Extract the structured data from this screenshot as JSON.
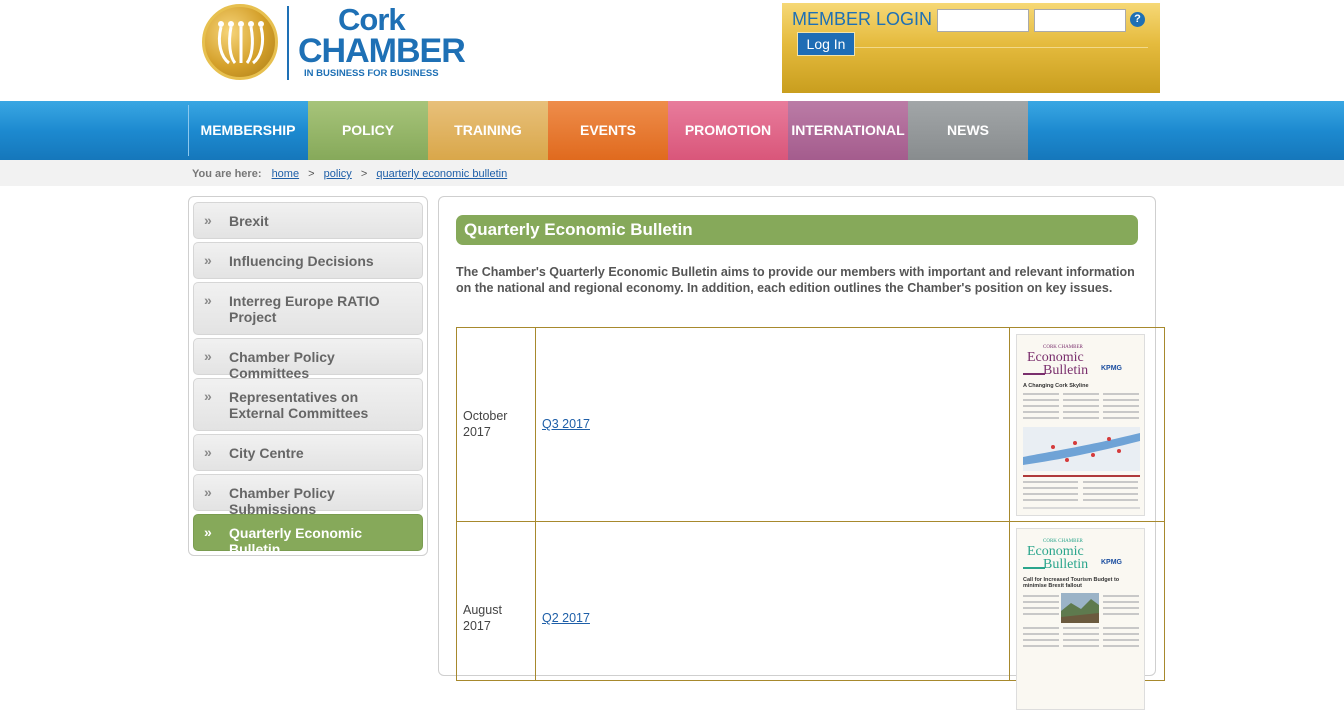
{
  "header": {
    "logo": {
      "word1": "Cork",
      "word2": "CHAMBER",
      "tagline": "IN BUSINESS FOR BUSINESS"
    },
    "login": {
      "title": "MEMBER LOGIN",
      "username_value": "",
      "password_value": "",
      "help_icon": "?",
      "button_label": "Log In"
    }
  },
  "nav": {
    "items": [
      {
        "label": "MEMBERSHIP",
        "color": "#1d8ad0"
      },
      {
        "label": "POLICY",
        "color": "#86a95a"
      },
      {
        "label": "TRAINING",
        "color": "#d9a74a"
      },
      {
        "label": "EVENTS",
        "color": "#e06a1e"
      },
      {
        "label": "PROMOTION",
        "color": "#d9567a"
      },
      {
        "label": "INTERNATIONAL",
        "color": "#a45c8d"
      },
      {
        "label": "NEWS",
        "color": "#888c8e"
      }
    ]
  },
  "breadcrumb": {
    "prefix": "You are here:",
    "links": [
      "home",
      "policy",
      "quarterly economic bulletin"
    ],
    "separator": ">"
  },
  "sidebar": {
    "arrow": "»",
    "items": [
      {
        "label": "Brexit",
        "active": false
      },
      {
        "label": "Influencing Decisions",
        "active": false
      },
      {
        "label": "Interreg Europe RATIO Project",
        "active": false
      },
      {
        "label": "Chamber Policy Committees",
        "active": false
      },
      {
        "label": "Representatives on External Committees",
        "active": false
      },
      {
        "label": "City Centre",
        "active": false
      },
      {
        "label": "Chamber Policy Submissions",
        "active": false
      },
      {
        "label": "Quarterly Economic Bulletin",
        "active": true
      }
    ]
  },
  "main": {
    "title": "Quarterly Economic Bulletin",
    "intro": "The Chamber's Quarterly Economic Bulletin aims to provide our members with important and relevant information on the national and regional economy. In addition, each edition outlines the Chamber's position on key issues.",
    "bulletins": [
      {
        "date": "October 2017",
        "link": "Q3 2017",
        "thumb": {
          "small": "CORK CHAMBER",
          "line1": "Economic",
          "line2": "Bulletin",
          "accent": "#7a2f6d",
          "brand": "KPMG",
          "headline": "A Changing Cork Skyline"
        }
      },
      {
        "date": "August 2017",
        "link": "Q2 2017",
        "thumb": {
          "small": "CORK CHAMBER",
          "line1": "Economic",
          "line2": "Bulletin",
          "accent": "#2aa58c",
          "brand": "KPMG",
          "headline": "Call for Increased Tourism Budget to minimise Brexit fallout"
        }
      }
    ]
  }
}
